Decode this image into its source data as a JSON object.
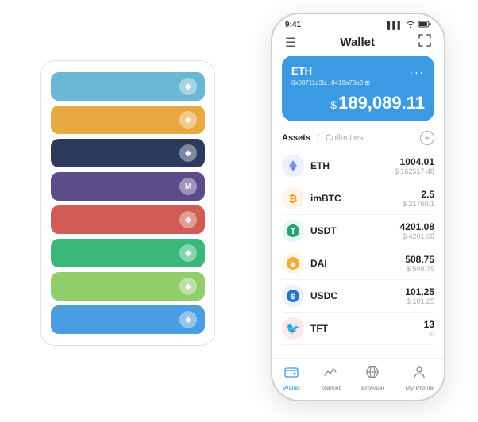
{
  "scene": {
    "card_stack": {
      "items": [
        {
          "color": "#6bb8d4",
          "icon": "◆"
        },
        {
          "color": "#e8a842",
          "icon": "◆"
        },
        {
          "color": "#2c3a5e",
          "icon": "◆"
        },
        {
          "color": "#5a4d8a",
          "icon": "M"
        },
        {
          "color": "#d05c55",
          "icon": "◆"
        },
        {
          "color": "#3ab87c",
          "icon": "◆"
        },
        {
          "color": "#8fce6a",
          "icon": "◆"
        },
        {
          "color": "#4a9de0",
          "icon": "◆"
        }
      ]
    }
  },
  "phone": {
    "status_bar": {
      "time": "9:41",
      "signal": "▌▌▌",
      "wifi": "WiFi",
      "battery": "🔋"
    },
    "nav": {
      "menu_icon": "☰",
      "title": "Wallet",
      "expand_icon": "⛶"
    },
    "eth_card": {
      "label": "ETH",
      "dots": "...",
      "address": "0x08711d3b...8418a78a3 ⊞",
      "dollar_sign": "$",
      "balance": "189,089.11"
    },
    "assets_header": {
      "active_tab": "Assets",
      "slash": "/",
      "inactive_tab": "Collecties",
      "add_icon": "+"
    },
    "assets": [
      {
        "icon": "♦",
        "icon_color": "#627eea",
        "icon_bg": "#eef0fc",
        "name": "ETH",
        "amount": "1004.01",
        "usd": "$ 162517.48"
      },
      {
        "icon": "₿",
        "icon_color": "#f7931a",
        "icon_bg": "#fff4e6",
        "name": "imBTC",
        "amount": "2.5",
        "usd": "$ 21760.1"
      },
      {
        "icon": "T",
        "icon_color": "#26a17b",
        "icon_bg": "#e6f7f2",
        "name": "USDT",
        "amount": "4201.08",
        "usd": "$ 4201.08"
      },
      {
        "icon": "◈",
        "icon_color": "#f5ac37",
        "icon_bg": "#fef7e6",
        "name": "DAI",
        "amount": "508.75",
        "usd": "$ 508.75"
      },
      {
        "icon": "$",
        "icon_color": "#2775ca",
        "icon_bg": "#e8f1fb",
        "name": "USDC",
        "amount": "101.25",
        "usd": "$ 101.25"
      },
      {
        "icon": "🐦",
        "icon_color": "#e0436c",
        "icon_bg": "#fce8ee",
        "name": "TFT",
        "amount": "13",
        "usd": "0"
      }
    ],
    "bottom_nav": [
      {
        "icon": "👛",
        "label": "Wallet",
        "active": true
      },
      {
        "icon": "📈",
        "label": "Market",
        "active": false
      },
      {
        "icon": "🌐",
        "label": "Browser",
        "active": false
      },
      {
        "icon": "👤",
        "label": "My Profile",
        "active": false
      }
    ]
  }
}
